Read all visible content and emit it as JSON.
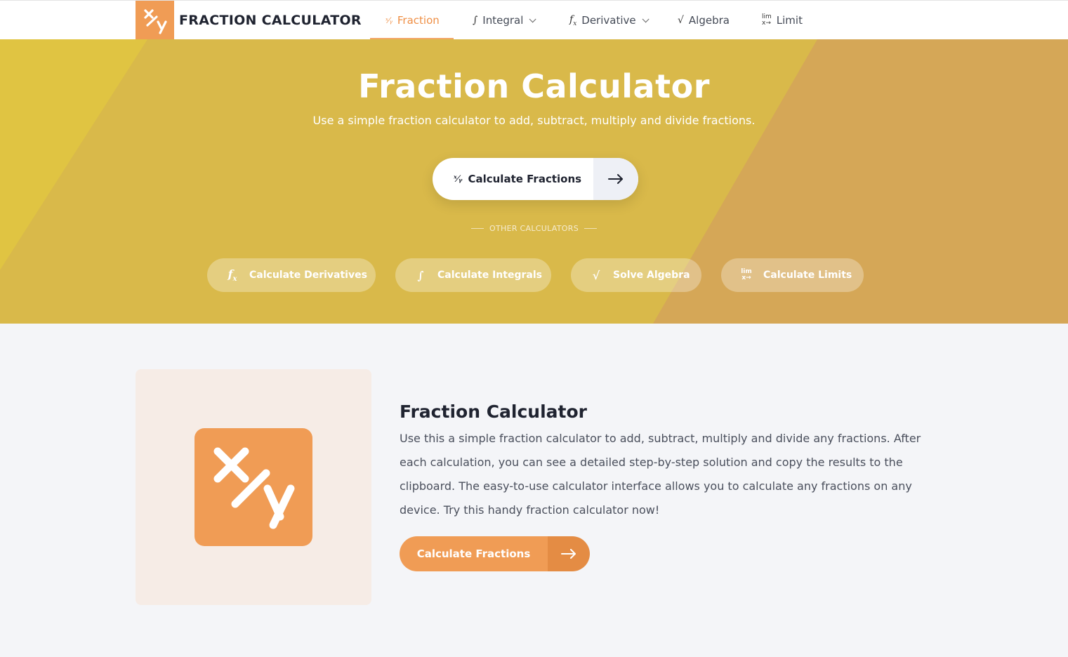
{
  "brand": {
    "name": "FRACTION CALCULATOR",
    "logo_icon": "fraction-xy-icon",
    "accent_color": "#f09c55"
  },
  "nav": {
    "items": [
      {
        "label": "Fraction",
        "icon_text": "x/y",
        "active": true
      },
      {
        "label": "Integral",
        "icon_text": "∫",
        "dropdown": true
      },
      {
        "label": "Derivative",
        "icon_text": "fx",
        "dropdown": true
      },
      {
        "label": "Algebra",
        "icon_text": "√"
      },
      {
        "label": "Limit",
        "icon_text": "lim"
      }
    ]
  },
  "hero": {
    "title": "Fraction Calculator",
    "subtitle": "Use a simple fraction calculator to add, subtract, multiply and divide fractions.",
    "cta_label": "Calculate Fractions",
    "other_label": "OTHER CALCULATORS",
    "pills": [
      {
        "label": "Calculate Derivatives",
        "icon_text": "fx"
      },
      {
        "label": "Calculate Integrals",
        "icon_text": "∫"
      },
      {
        "label": "Solve Algebra",
        "icon_text": "√"
      },
      {
        "label": "Calculate Limits",
        "icon_text": "lim"
      }
    ],
    "colors": {
      "base": "#d9b94a",
      "left": "#e0c442",
      "right": "#d5a757"
    }
  },
  "content": {
    "title": "Fraction Calculator",
    "description": "Use this a simple fraction calculator to add, subtract, multiply and divide any fractions. After each calculation, you can see a detailed step-by-step solution and copy the results to the clipboard. The easy-to-use calculator interface allows you to calculate any fractions on any device. Try this handy fraction calculator now!",
    "button_label": "Calculate Fractions"
  }
}
